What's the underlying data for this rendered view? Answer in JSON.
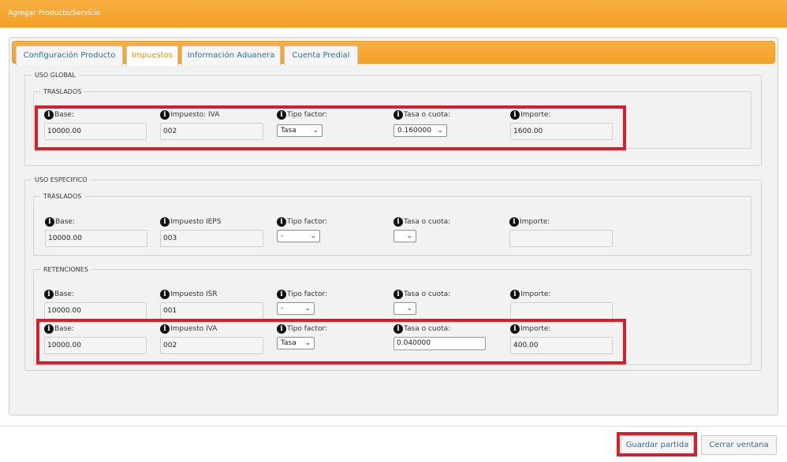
{
  "window": {
    "title": "Agregar Producto/Servicio"
  },
  "tabs": [
    {
      "label": "Configuración Producto"
    },
    {
      "label": "Impuestos"
    },
    {
      "label": "Información Aduanera"
    },
    {
      "label": "Cuenta Predial"
    }
  ],
  "uso_global": {
    "legend": "USO GLOBAL",
    "traslados": {
      "legend": "TRASLADOS",
      "base_label": "Base:",
      "base_value": "10000.00",
      "impuesto_label": "Impuesto: IVA",
      "impuesto_value": "002",
      "tipo_factor_label": "Tipo factor:",
      "tipo_factor_value": "Tasa",
      "tasa_label": "Tasa o cuota:",
      "tasa_value": "0.160000",
      "importe_label": "Importe:",
      "importe_value": "1600.00"
    }
  },
  "uso_especifico": {
    "legend": "USO ESPECIFICO",
    "traslados": {
      "legend": "TRASLADOS",
      "base_label": "Base:",
      "base_value": "10000.00",
      "impuesto_label": "Impuesto IEPS",
      "impuesto_value": "003",
      "tipo_factor_label": "Tipo factor:",
      "tipo_factor_value": "-",
      "tasa_label": "Tasa o cuota:",
      "tasa_value": "",
      "importe_label": "Importe:",
      "importe_value": ""
    },
    "retenciones": {
      "legend": "RETENCIONES",
      "isr": {
        "base_label": "Base:",
        "base_value": "10000.00",
        "impuesto_label": "Impuesto ISR",
        "impuesto_value": "001",
        "tipo_factor_label": "Tipo factor:",
        "tipo_factor_value": "-",
        "tasa_label": "Tasa o cuota:",
        "tasa_value": "",
        "importe_label": "Importe:",
        "importe_value": ""
      },
      "iva": {
        "base_label": "Base:",
        "base_value": "10000.00",
        "impuesto_label": "Impuesto IVA",
        "impuesto_value": "002",
        "tipo_factor_label": "Tipo factor:",
        "tipo_factor_value": "Tasa",
        "tasa_label": "Tasa o cuota:",
        "tasa_value": "0.040000",
        "importe_label": "Importe:",
        "importe_value": "400.00"
      }
    }
  },
  "buttons": {
    "save": "Guardar partida",
    "close": "Cerrar ventana"
  },
  "colors": {
    "header_orange": "#f4a024",
    "highlight_red": "#d4202c",
    "tab_text_blue": "#2e6e9e",
    "active_tab_orange": "#e88f14"
  },
  "icons": {
    "info": "info-circle-icon",
    "dropdown": "chevron-down-icon"
  }
}
